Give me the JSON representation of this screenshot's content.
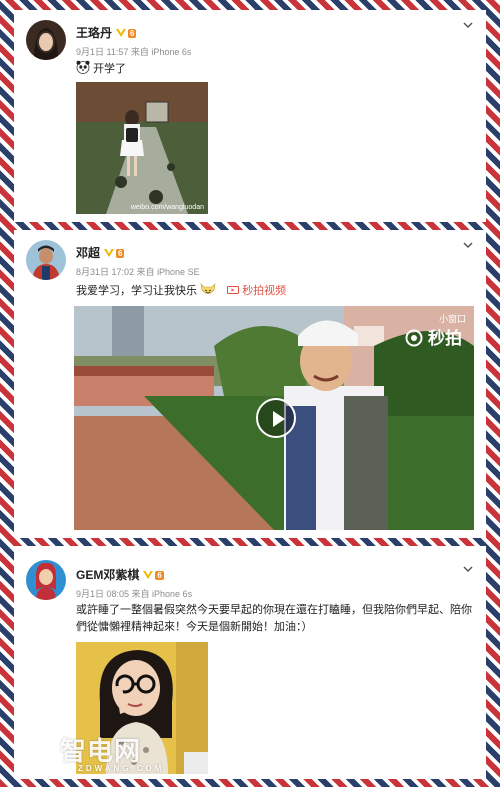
{
  "posts": [
    {
      "author": "王珞丹",
      "level_badge": "6",
      "meta": "9月1日 11:57 来自 iPhone 6s",
      "text": "开学了",
      "emoji_icon": "panda-icon",
      "image_watermark": "weibo.com/wangluodan"
    },
    {
      "author": "邓超",
      "level_badge": "6",
      "meta": "8月31日 17:02 来自 iPhone SE",
      "text": "我爱学习，学习让我快乐",
      "emoji_icon": "happy-face-icon",
      "video_link": "秒拍视频",
      "video_mini_label": "小窗口",
      "video_brand": "秒拍"
    },
    {
      "author": "GEM邓紫棋",
      "level_badge": "6",
      "meta": "9月1日 08:05 来自 iPhone 6s",
      "text": "或許睡了一整個暑假突然今天要早起的你現在還在打瞌睡，但我陪你們早起、陪你們從慵懶裡精神起來！今天是個新開始！加油：）"
    }
  ],
  "site_watermark": {
    "main": "智电网",
    "sub": "ZDWANG.COM"
  },
  "colors": {
    "accent": "#e05244",
    "vip": "#f0b600",
    "text": "#222222",
    "meta": "#8c8c8c"
  }
}
